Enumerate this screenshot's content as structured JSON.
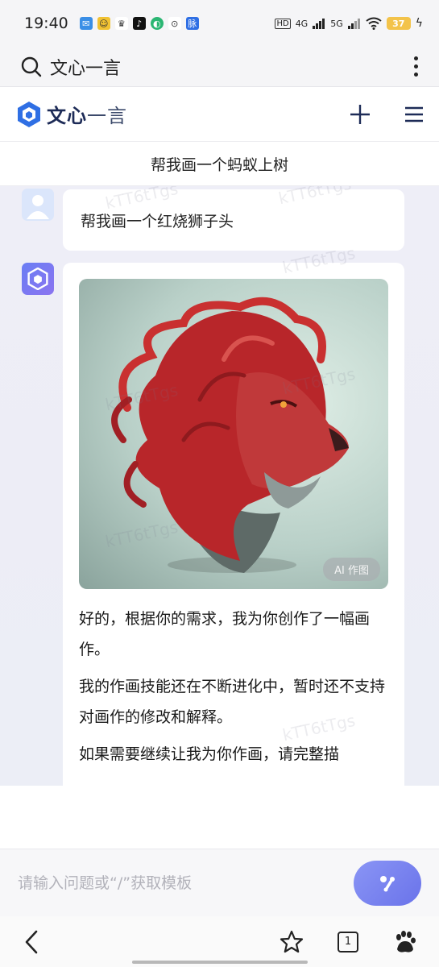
{
  "status_bar": {
    "time": "19:40",
    "battery": "37",
    "network_1": "4G",
    "network_2": "5G"
  },
  "browser": {
    "search_title": "文心一言"
  },
  "app": {
    "brand_bold": "文心",
    "brand_light": "一言"
  },
  "chat": {
    "title": "帮我画一个蚂蚁上树",
    "user_message": "帮我画一个红烧狮子头",
    "image_badge": "AI 作图",
    "bot_paragraphs": [
      "好的，根据你的需求，我为你创作了一幅画作。",
      "我的作画技能还在不断进化中，暂时还不支持对画作的修改和解释。",
      "如果需要继续让我为你作画，请完整描"
    ]
  },
  "input": {
    "placeholder": "请输入问题或“/”获取模板"
  },
  "bottom_nav": {
    "tab_count": "1"
  },
  "watermark_text": "kTT6tTgs",
  "colors": {
    "accent": "#6a73ea",
    "brand": "#1d2b57"
  }
}
